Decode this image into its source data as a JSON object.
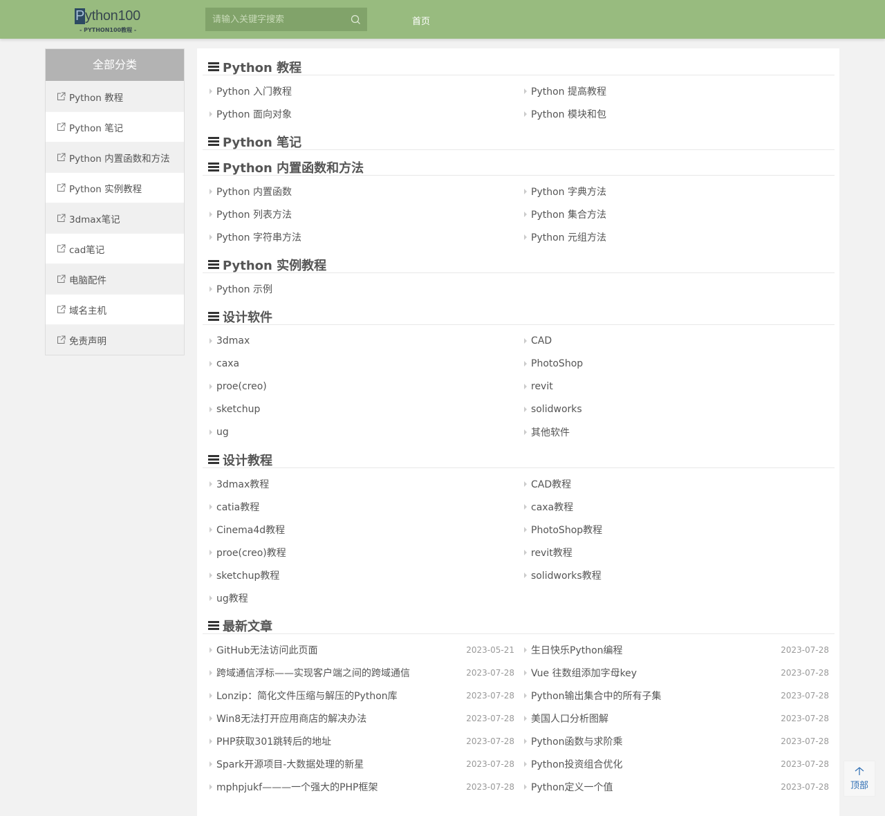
{
  "header": {
    "logo_main": "Python100",
    "logo_sub": "- PYTHON100教程 -",
    "search_placeholder": "请输入关键字搜索",
    "nav_home": "首页"
  },
  "sidebar": {
    "title": "全部分类",
    "items": [
      "Python 教程",
      "Python 笔记",
      "Python 内置函数和方法",
      "Python 实例教程",
      "3dmax笔记",
      "cad笔记",
      "电脑配件",
      "域名主机",
      "免责声明"
    ]
  },
  "sections": [
    {
      "title": "Python 教程",
      "items": [
        "Python 入门教程",
        "Python 提高教程",
        "Python 面向对象",
        "Python 模块和包"
      ]
    },
    {
      "title": "Python 笔记",
      "items": []
    },
    {
      "title": "Python 内置函数和方法",
      "items": [
        "Python 内置函数",
        "Python 字典方法",
        "Python 列表方法",
        "Python 集合方法",
        "Python 字符串方法",
        "Python 元组方法"
      ]
    },
    {
      "title": "Python 实例教程",
      "items": [
        "Python 示例"
      ]
    },
    {
      "title": "设计软件",
      "items": [
        "3dmax",
        "CAD",
        "caxa",
        "PhotoShop",
        "proe(creo)",
        "revit",
        "sketchup",
        "solidworks",
        "ug",
        "其他软件"
      ]
    },
    {
      "title": "设计教程",
      "items": [
        "3dmax教程",
        "CAD教程",
        "catia教程",
        "caxa教程",
        "Cinema4d教程",
        "PhotoShop教程",
        "proe(creo)教程",
        "revit教程",
        "sketchup教程",
        "solidworks教程",
        "ug教程"
      ]
    }
  ],
  "latest": {
    "title": "最新文章",
    "items": [
      {
        "title": "GitHub无法访问此页面",
        "date": "2023-05-21"
      },
      {
        "title": "生日快乐Python编程",
        "date": "2023-07-28"
      },
      {
        "title": "跨域通信浮标——实现客户端之间的跨域通信",
        "date": "2023-07-28"
      },
      {
        "title": "Vue 往数组添加字母key",
        "date": "2023-07-28"
      },
      {
        "title": "Lonzip：简化文件压缩与解压的Python库",
        "date": "2023-07-28"
      },
      {
        "title": "Python输出集合中的所有子集",
        "date": "2023-07-28"
      },
      {
        "title": "Win8无法打开应用商店的解决办法",
        "date": "2023-07-28"
      },
      {
        "title": "美国人口分析图解",
        "date": "2023-07-28"
      },
      {
        "title": "PHP获取301跳转后的地址",
        "date": "2023-07-28"
      },
      {
        "title": "Python函数与求阶乘",
        "date": "2023-07-28"
      },
      {
        "title": "Spark开源项目-大数据处理的新星",
        "date": "2023-07-28"
      },
      {
        "title": "Python投资组合优化",
        "date": "2023-07-28"
      },
      {
        "title": "mphpjukf———一个强大的PHP框架",
        "date": "2023-07-28"
      },
      {
        "title": "Python定义一个值",
        "date": "2023-07-28"
      }
    ]
  },
  "totop": "顶部"
}
